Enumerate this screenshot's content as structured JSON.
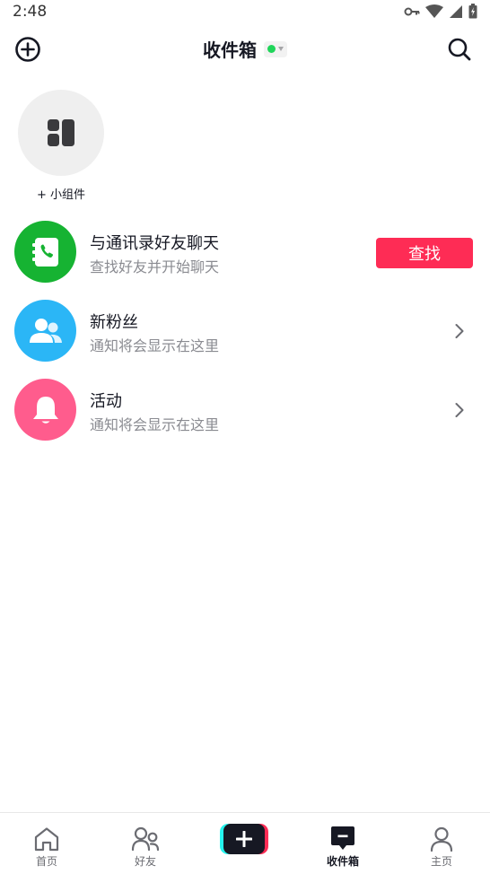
{
  "status_bar": {
    "time": "2:48"
  },
  "header": {
    "title": "收件箱"
  },
  "widget": {
    "label": "+ 小组件"
  },
  "rows": [
    {
      "title": "与通讯录好友聊天",
      "subtitle": "查找好友并开始聊天",
      "action": "查找",
      "icon": "phone-contact-icon",
      "color": "#16b332"
    },
    {
      "title": "新粉丝",
      "subtitle": "通知将会显示在这里",
      "icon": "people-icon",
      "color": "#2bb6f6"
    },
    {
      "title": "活动",
      "subtitle": "通知将会显示在这里",
      "icon": "bell-icon",
      "color": "#ff5c8d"
    }
  ],
  "bottom_nav": {
    "items": [
      {
        "label": "首页",
        "icon": "home-icon"
      },
      {
        "label": "好友",
        "icon": "friends-icon"
      },
      {
        "label": "",
        "icon": "create-plus-icon"
      },
      {
        "label": "收件箱",
        "icon": "inbox-icon",
        "active": true
      },
      {
        "label": "主页",
        "icon": "profile-icon"
      }
    ]
  },
  "colors": {
    "accent": "#fe2c55",
    "text_primary": "#161823",
    "text_secondary": "#8a8b91"
  }
}
